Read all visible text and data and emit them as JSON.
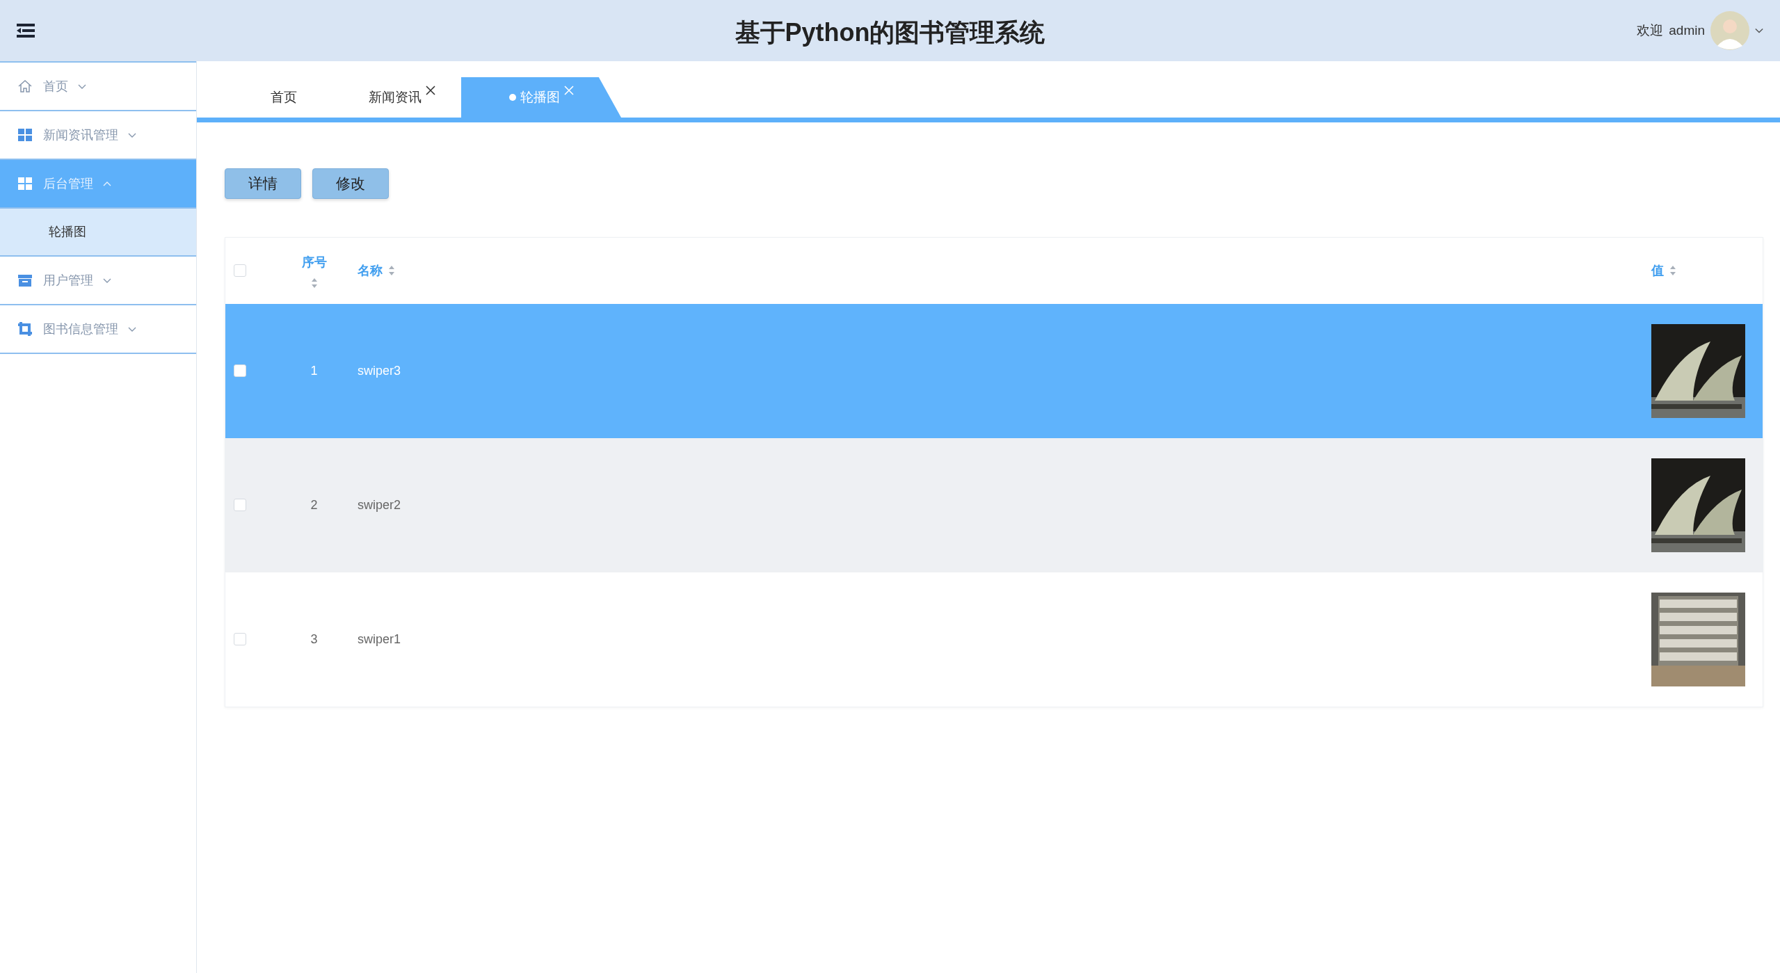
{
  "header": {
    "title": "基于Python的图书管理系统",
    "welcome": "欢迎",
    "user": "admin"
  },
  "sidebar": {
    "items": [
      {
        "label": "首页",
        "expanded": false
      },
      {
        "label": "新闻资讯管理",
        "expanded": false
      },
      {
        "label": "后台管理",
        "expanded": true,
        "children": [
          {
            "label": "轮播图",
            "selected": true
          }
        ]
      },
      {
        "label": "用户管理",
        "expanded": false
      },
      {
        "label": "图书信息管理",
        "expanded": false
      }
    ]
  },
  "tabs": [
    {
      "label": "首页",
      "selected": false,
      "closable": false
    },
    {
      "label": "新闻资讯",
      "selected": false,
      "closable": true
    },
    {
      "label": "轮播图",
      "selected": true,
      "closable": true
    }
  ],
  "buttons": [
    "详情",
    "修改"
  ],
  "table": {
    "all_checked": false,
    "columns": [
      "序号",
      "名称",
      "值"
    ],
    "rows": [
      {
        "index": "1",
        "name": "swiper3",
        "selected": true,
        "checked": false
      },
      {
        "index": "2",
        "name": "swiper2",
        "selected": false,
        "checked": false
      },
      {
        "index": "3",
        "name": "swiper1",
        "selected": false,
        "checked": false
      }
    ]
  }
}
